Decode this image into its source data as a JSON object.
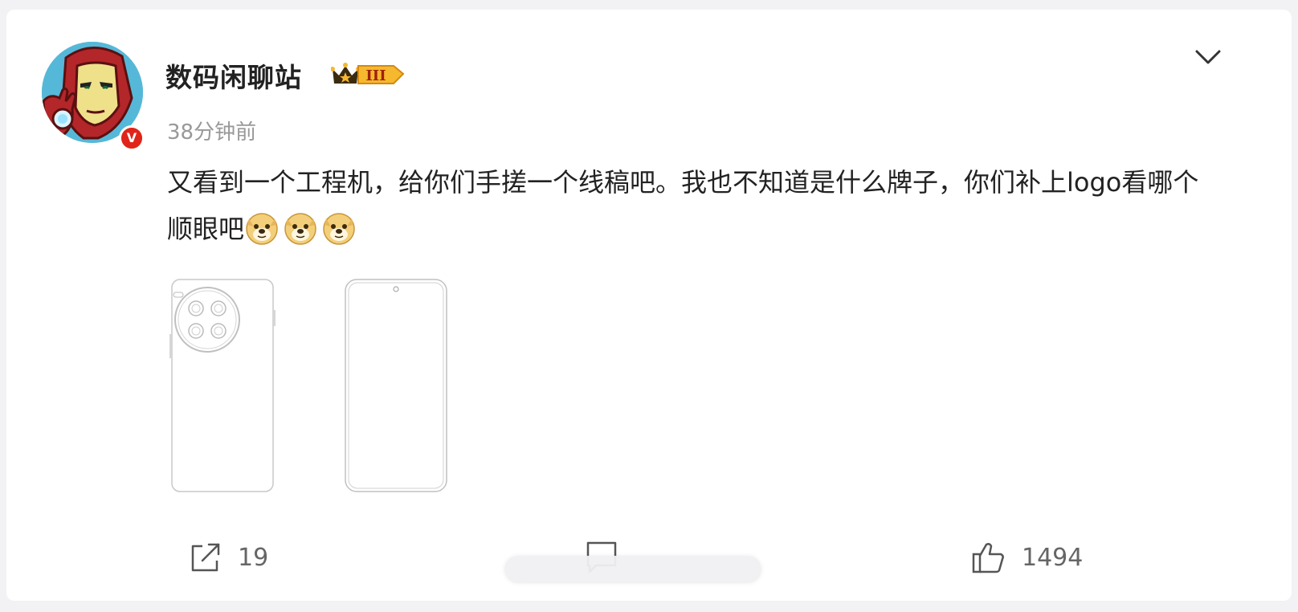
{
  "post": {
    "author": {
      "name": "数码闲聊站",
      "rank_label": "III",
      "verified_label": "V"
    },
    "time": "38分钟前",
    "text": "又看到一个工程机，给你们手搓一个线稿吧。我也不知道是什么牌子，你们补上logo看哪个顺眼吧",
    "emojis": [
      "doge",
      "doge",
      "doge"
    ],
    "images": [
      {
        "icon": "phone-back-sketch"
      },
      {
        "icon": "phone-front-sketch"
      }
    ]
  },
  "actions": {
    "share": {
      "icon": "share-icon",
      "count": "19"
    },
    "comment": {
      "icon": "comment-icon",
      "count": ""
    },
    "like": {
      "icon": "thumbs-up-icon",
      "count": "1494"
    }
  },
  "colors": {
    "background": "#f2f2f4",
    "card": "#ffffff",
    "text": "#222222",
    "muted": "#999999",
    "verified": "#e0241b",
    "rank_gold": "#f5b82e"
  }
}
